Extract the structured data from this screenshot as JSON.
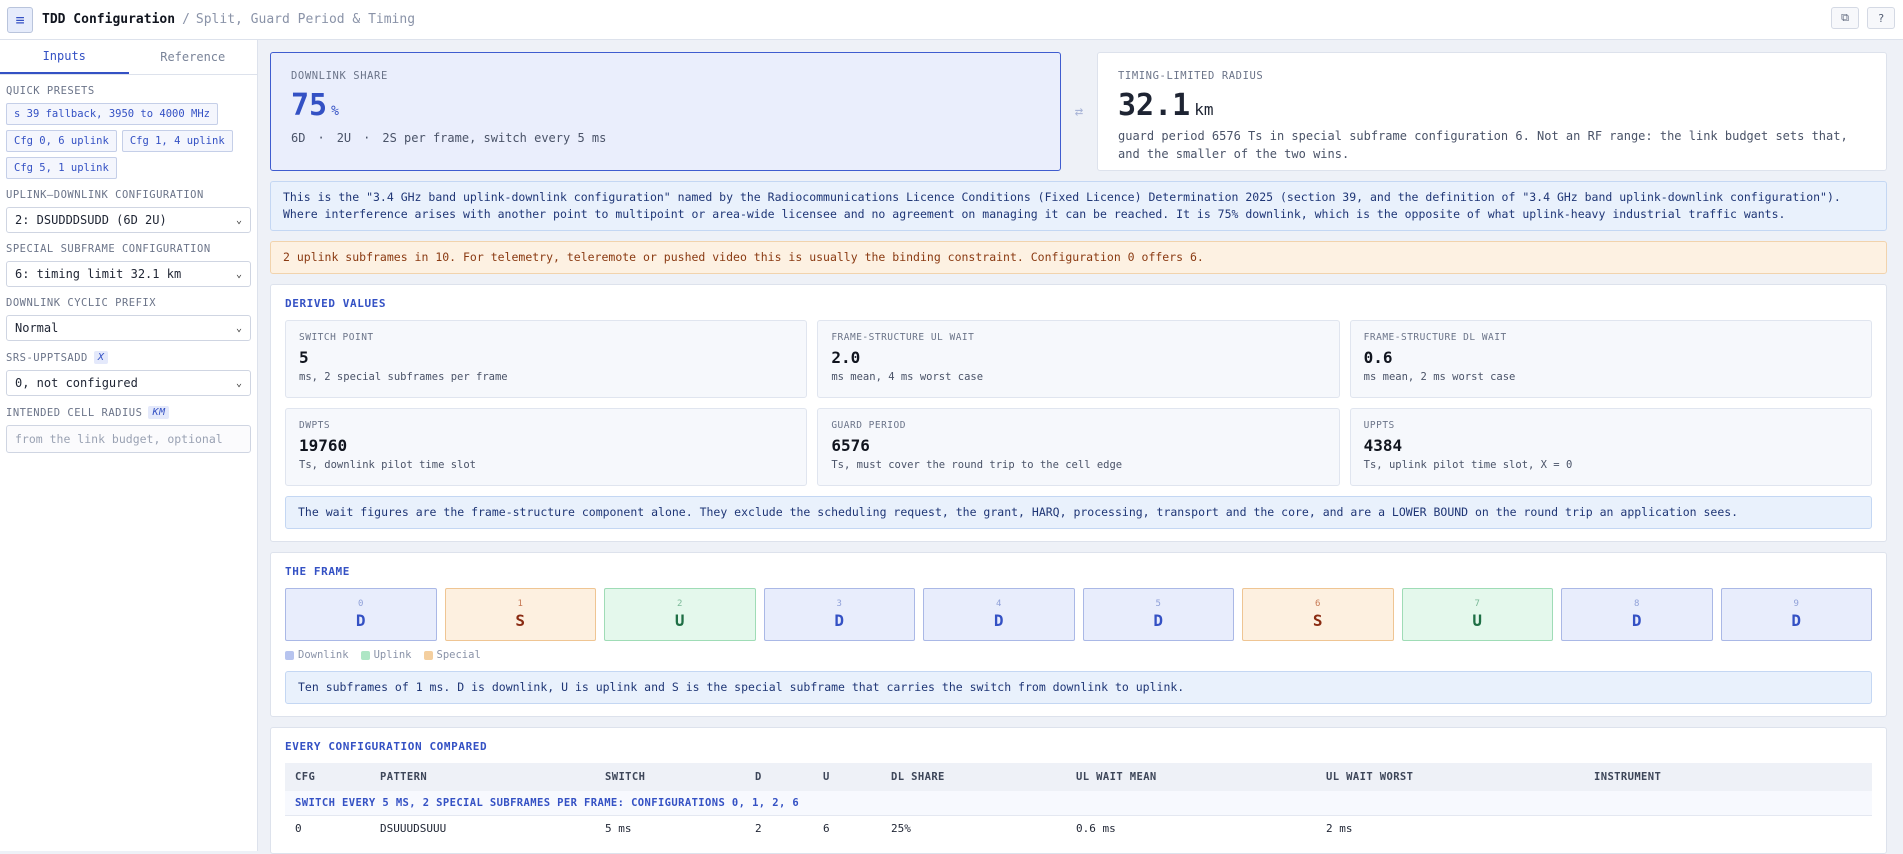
{
  "header": {
    "title": "TDD Configuration",
    "separator": "/",
    "subtitle": "Split, Guard Period & Timing"
  },
  "sidebar": {
    "tabs": [
      "Inputs",
      "Reference"
    ],
    "presets_label": "QUICK PRESETS",
    "presets": [
      "s 39 fallback, 3950 to 4000 MHz",
      "Cfg 0, 6 uplink",
      "Cfg 1, 4 uplink",
      "Cfg 5, 1 uplink"
    ],
    "uldl_label": "UPLINK–DOWNLINK CONFIGURATION",
    "uldl_value": "2: DSUDDDSUDD (6D 2U)",
    "special_label": "SPECIAL SUBFRAME CONFIGURATION",
    "special_value": "6: timing limit 32.1 km",
    "cp_label": "DOWNLINK CYCLIC PREFIX",
    "cp_value": "Normal",
    "srs_label": "SRS-UPPTSADD",
    "srs_unit": "X",
    "srs_value": "0, not configured",
    "radius_label": "INTENDED CELL RADIUS",
    "radius_unit": "KM",
    "radius_placeholder": "from the link budget, optional"
  },
  "hero": {
    "dl_label": "DOWNLINK SHARE",
    "dl_value": "75",
    "dl_unit": "%",
    "dl_d": "6D",
    "dl_u": "2U",
    "dl_s": "2S per frame, switch every 5 ms",
    "dot": "·",
    "swap_icon": "⇄",
    "radius_label": "TIMING-LIMITED RADIUS",
    "radius_value": "32.1",
    "radius_unit": "km",
    "radius_note": "guard period 6576 Ts in special subframe configuration 6. Not an RF range: the link budget sets that, and the smaller of the two wins."
  },
  "notes": {
    "licence": "This is the \"3.4 GHz band uplink-downlink configuration\" named by the Radiocommunications Licence Conditions (Fixed Licence) Determination 2025 (section 39, and the definition of \"3.4 GHz band uplink-downlink configuration\"). Where interference arises with another point to multipoint or area-wide licensee and no agreement on managing it can be reached. It is 75% downlink, which is the opposite of what uplink-heavy industrial traffic wants.",
    "warning": "2 uplink subframes in 10. For telemetry, teleremote or pushed video this is usually the binding constraint. Configuration 0 offers 6."
  },
  "derived": {
    "title": "DERIVED VALUES",
    "items": [
      {
        "label": "SWITCH POINT",
        "value": "5",
        "note": "ms, 2 special subframes per frame"
      },
      {
        "label": "FRAME-STRUCTURE UL WAIT",
        "value": "2.0",
        "note": "ms mean, 4 ms worst case"
      },
      {
        "label": "FRAME-STRUCTURE DL WAIT",
        "value": "0.6",
        "note": "ms mean, 2 ms worst case"
      },
      {
        "label": "DWPTS",
        "value": "19760",
        "note": "Ts, downlink pilot time slot"
      },
      {
        "label": "GUARD PERIOD",
        "value": "6576",
        "note": "Ts, must cover the round trip to the cell edge"
      },
      {
        "label": "UPPTS",
        "value": "4384",
        "note": "Ts, uplink pilot time slot, X = 0"
      }
    ],
    "footnote": "The wait figures are the frame-structure component alone. They exclude the scheduling request, the grant, HARQ, processing, transport and the core, and are a LOWER BOUND on the round trip an application sees."
  },
  "frame": {
    "title": "THE FRAME",
    "subframes": [
      {
        "idx": "0",
        "type": "D"
      },
      {
        "idx": "1",
        "type": "S"
      },
      {
        "idx": "2",
        "type": "U"
      },
      {
        "idx": "3",
        "type": "D"
      },
      {
        "idx": "4",
        "type": "D"
      },
      {
        "idx": "5",
        "type": "D"
      },
      {
        "idx": "6",
        "type": "S"
      },
      {
        "idx": "7",
        "type": "U"
      },
      {
        "idx": "8",
        "type": "D"
      },
      {
        "idx": "9",
        "type": "D"
      }
    ],
    "legend": [
      "Downlink",
      "Uplink",
      "Special"
    ],
    "note": "Ten subframes of 1 ms. D is downlink, U is uplink and S is the special subframe that carries the switch from downlink to uplink."
  },
  "compare": {
    "title": "EVERY CONFIGURATION COMPARED",
    "headers": [
      "CFG",
      "PATTERN",
      "SWITCH",
      "D",
      "U",
      "DL SHARE",
      "UL WAIT MEAN",
      "UL WAIT WORST",
      "INSTRUMENT"
    ],
    "group1": "SWITCH EVERY 5 MS, 2 SPECIAL SUBFRAMES PER FRAME: CONFIGURATIONS 0, 1, 2, 6",
    "row0": [
      "0",
      "DSUUUDSUUU",
      "5 ms",
      "2",
      "6",
      "25%",
      "0.6 ms",
      "2 ms",
      ""
    ]
  }
}
